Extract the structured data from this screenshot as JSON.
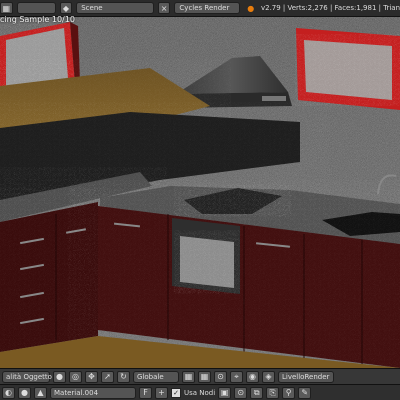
{
  "top": {
    "scene_label": "Scene",
    "renderer": "Cycles Render",
    "stats": "v2.79 | Verts:2,276 | Faces:1,981 | Trian"
  },
  "viewport": {
    "status": "cing Sample 10/10"
  },
  "header": {
    "mode": "alità Oggetto",
    "pivot": "Globale",
    "layer": "LivelloRender"
  },
  "node_bar": {
    "material": "Material.004",
    "use_nodes": "Usa Nodi"
  }
}
